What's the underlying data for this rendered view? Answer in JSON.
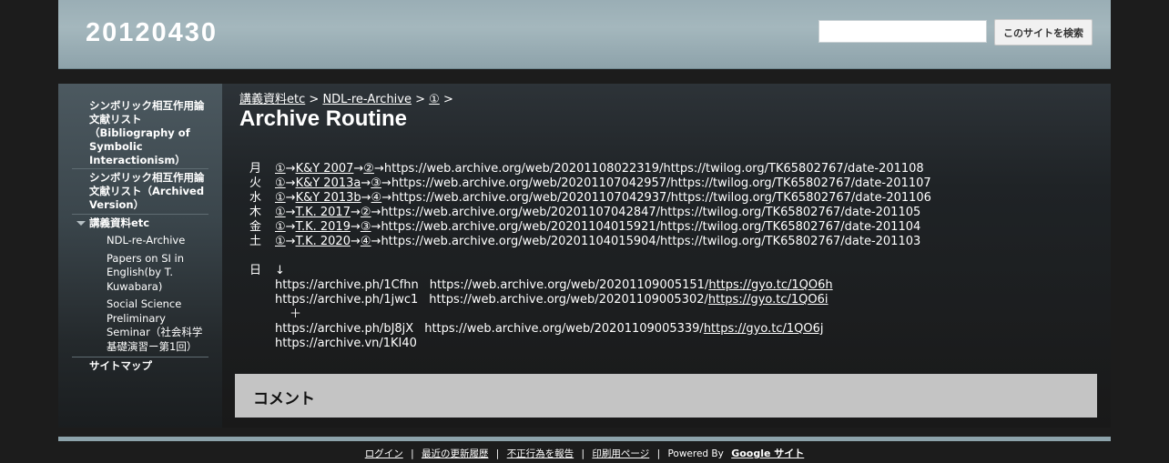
{
  "header": {
    "site_title": "20120430",
    "search_placeholder": "",
    "search_button": "このサイトを検索"
  },
  "sidebar": {
    "items": [
      {
        "label": "シンボリック相互作用論文献リスト（Bibliography of Symbolic Interactionism）"
      },
      {
        "label": "シンボリック相互作用論文献リスト（Archived Version）"
      },
      {
        "label": "講義資料etc"
      },
      {
        "label": "サイトマップ"
      }
    ],
    "subitems": [
      {
        "label": "NDL-re-Archive"
      },
      {
        "label": "Papers on SI in English(by T. Kuwabara)"
      },
      {
        "label": "Social Science Preliminary Seminar（社会科学基礎演習ー第1回）"
      }
    ]
  },
  "breadcrumb": {
    "items": [
      "講義資料etc",
      "NDL-re-Archive",
      "①"
    ],
    "sep": ">"
  },
  "page": {
    "title": "Archive Routine"
  },
  "routine": [
    {
      "day": "月",
      "l1": "①",
      "a1": "→",
      "l2": "K&Y 2007",
      "a2": "→",
      "l3": "②",
      "a3": "→",
      "url": "https://web.archive.org/web/20201108022319/https://twilog.org/TK65802767/date-201108"
    },
    {
      "day": "火",
      "l1": "①",
      "a1": "→",
      "l2": "K&Y 2013a",
      "a2": "→",
      "l3": "③",
      "a3": "→",
      "url": "https://web.archive.org/web/20201107042957/https://twilog.org/TK65802767/date-201107"
    },
    {
      "day": "水",
      "l1": "①",
      "a1": "→",
      "l2": "K&Y 2013b",
      "a2": "→",
      "l3": "④",
      "a3": "→",
      "url": "https://web.archive.org/web/20201107042937/https://twilog.org/TK65802767/date-201106"
    },
    {
      "day": "木",
      "l1": "①",
      "a1": "→",
      "l2": "T.K. 2017",
      "a2": "→",
      "l3": "②",
      "a3": "→",
      "url": "https://web.archive.org/web/20201107042847/https://twilog.org/TK65802767/date-201105"
    },
    {
      "day": "金",
      "l1": "①",
      "a1": "→",
      "l2": "T.K. 2019",
      "a2": "→",
      "l3": "③",
      "a3": "→",
      "url": "https://web.archive.org/web/20201104015921/https://twilog.org/TK65802767/date-201104"
    },
    {
      "day": "土",
      "l1": "①",
      "a1": "→",
      "l2": "T.K. 2020",
      "a2": "→",
      "l3": "④",
      "a3": "→",
      "url": "https://web.archive.org/web/20201104015904/https://twilog.org/TK65802767/date-201103"
    }
  ],
  "sunday": {
    "day": "日",
    "arrow": "↓",
    "rows": [
      {
        "a": "https://archive.ph/1Cfhn",
        "b": "https://web.archive.org/web/20201109005151/",
        "c": "https://gyo.tc/1QO6h"
      },
      {
        "a": "https://archive.ph/1jwc1",
        "b": "https://web.archive.org/web/20201109005302/",
        "c": "https://gyo.tc/1QO6i"
      },
      {
        "a": "https://archive.ph/bJ8jX",
        "b": "https://web.archive.org/web/20201109005339/",
        "c": "https://gyo.tc/1QO6j"
      }
    ],
    "plus": "＋",
    "last": "https://archive.vn/1KI40"
  },
  "comments": {
    "title": "コメント"
  },
  "footer": {
    "login": "ログイン",
    "recent": "最近の更新履歴",
    "abuse": "不正行為を報告",
    "print": "印刷用ページ",
    "sep": "|",
    "powered": "Powered By",
    "google_sites": "Google サイト"
  }
}
